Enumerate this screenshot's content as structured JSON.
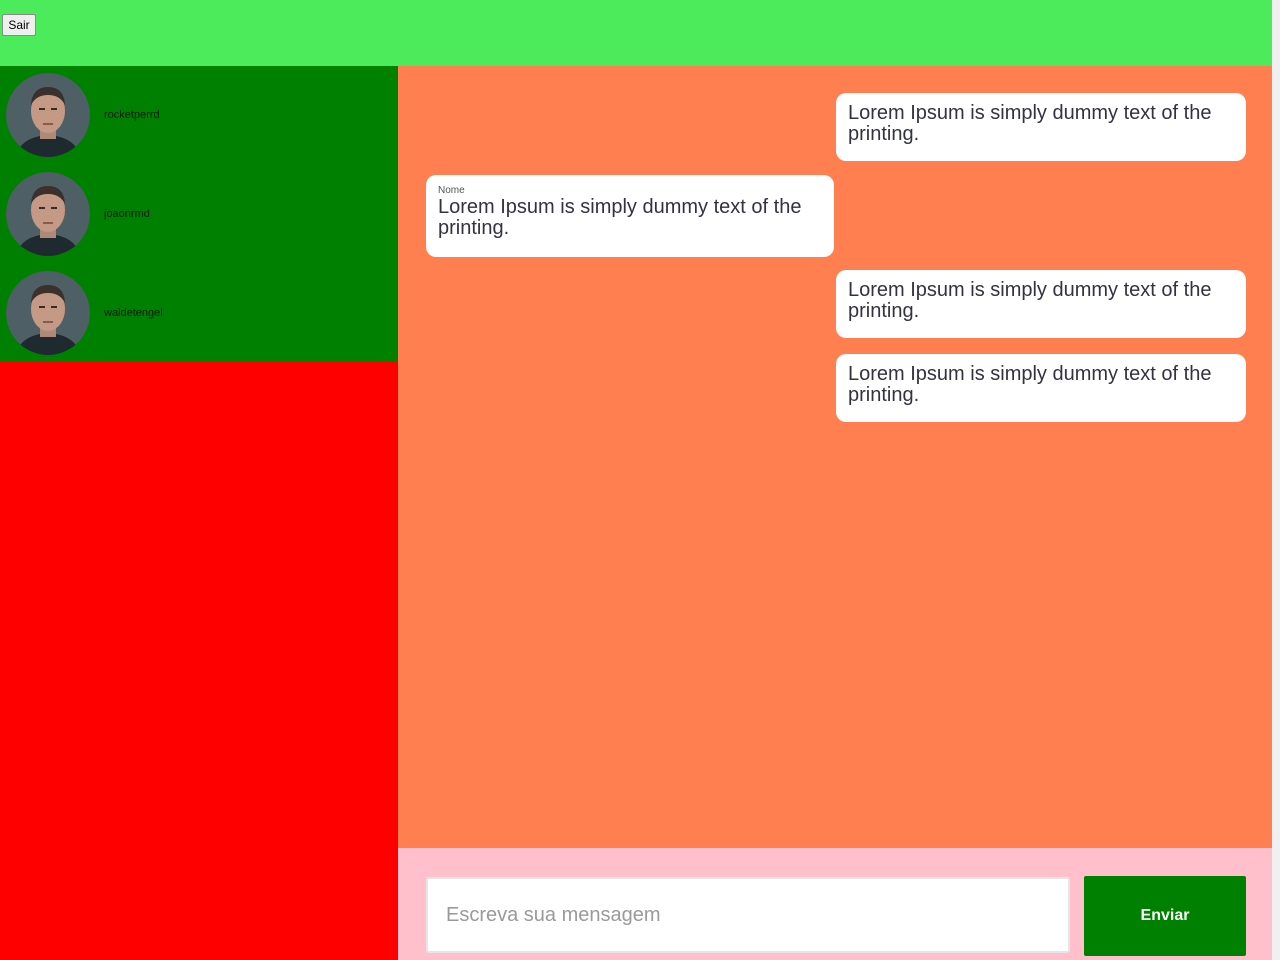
{
  "header": {
    "logout_label": "Sair"
  },
  "contacts": [
    {
      "name": "rocketperrd",
      "avatar": "user-avatar-photo"
    },
    {
      "name": "joaonrmd",
      "avatar": "user-avatar-photo"
    },
    {
      "name": "waldetengel",
      "avatar": "user-avatar-photo"
    }
  ],
  "messages": [
    {
      "direction": "outgoing",
      "sender": "",
      "text": "Lorem Ipsum is simply dummy text of the printing."
    },
    {
      "direction": "incoming",
      "sender": "Nome",
      "text": "Lorem Ipsum is simply dummy text of the printing."
    },
    {
      "direction": "outgoing",
      "sender": "",
      "text": "Lorem Ipsum is simply dummy text of the printing."
    },
    {
      "direction": "outgoing",
      "sender": "",
      "text": "Lorem Ipsum is simply dummy text of the printing."
    }
  ],
  "composer": {
    "placeholder": "Escreva sua mensagem",
    "value": "",
    "send_label": "Enviar"
  },
  "colors": {
    "header": "#4ceb5c",
    "contacts_panel": "#008000",
    "sidebar": "#ff0000",
    "chat_area": "#ff7f50",
    "composer": "#ffc0cb",
    "send_button": "#008000"
  }
}
